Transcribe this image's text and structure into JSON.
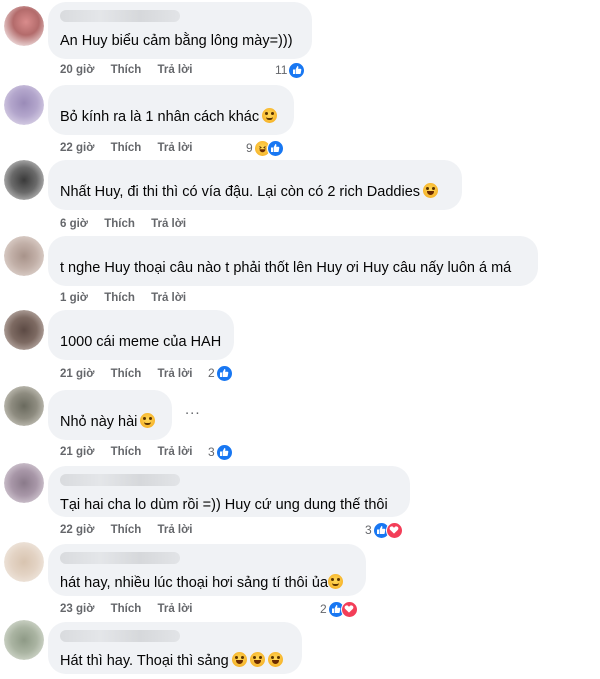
{
  "actions": {
    "like": "Thích",
    "reply": "Trả lời"
  },
  "comments": [
    {
      "text": "An Huy biểu cảm bằng lông mày=)))",
      "time": "20 giờ",
      "reactions": {
        "count": "11",
        "types": [
          "like-icon"
        ]
      }
    },
    {
      "text": "Bỏ kính ra là 1 nhân cách khác",
      "emojis": [
        "rolling-eyes-emoji"
      ],
      "time": "22 giờ",
      "reactions": {
        "count": "9",
        "types": [
          "haha-icon",
          "like-icon"
        ]
      }
    },
    {
      "text": "Nhất Huy, đi thi thì có vía đậu. Lại còn có 2 rich Daddies",
      "emojis": [
        "rofl-emoji"
      ],
      "time": "6 giờ"
    },
    {
      "text": "t nghe Huy thoại câu nào t phải thốt lên Huy ơi Huy câu nấy luôn á má",
      "time": "1 giờ"
    },
    {
      "text": "1000 cái meme của HAH",
      "time": "21 giờ",
      "reactions": {
        "count": "2",
        "types": [
          "like-icon"
        ]
      }
    },
    {
      "text": "Nhỏ này hài",
      "emojis": [
        "smirk-emoji"
      ],
      "time": "21 giờ",
      "reactions": {
        "count": "3",
        "types": [
          "like-icon"
        ]
      }
    },
    {
      "text": "Tại hai cha lo dùm rồi =)) Huy cứ ung dung thế thôi",
      "time": "22 giờ",
      "reactions": {
        "count": "3",
        "types": [
          "like-icon",
          "love-icon"
        ]
      }
    },
    {
      "text": "hát hay, nhiều lúc thoại hơi sảng tí thôi ủa",
      "emojis": [
        "grin-sweat-emoji"
      ],
      "time": "23 giờ",
      "reactions": {
        "count": "2",
        "types": [
          "like-icon",
          "love-icon"
        ]
      }
    },
    {
      "text": "Hát thì hay. Thoại thì sảng",
      "emojis": [
        "rofl-emoji",
        "rofl-emoji",
        "rofl-emoji"
      ]
    }
  ],
  "more_menu": "...",
  "colors": {
    "like": "#1877f2",
    "love": "#f33e58",
    "bubble": "#f0f2f5",
    "meta": "#65676b"
  }
}
